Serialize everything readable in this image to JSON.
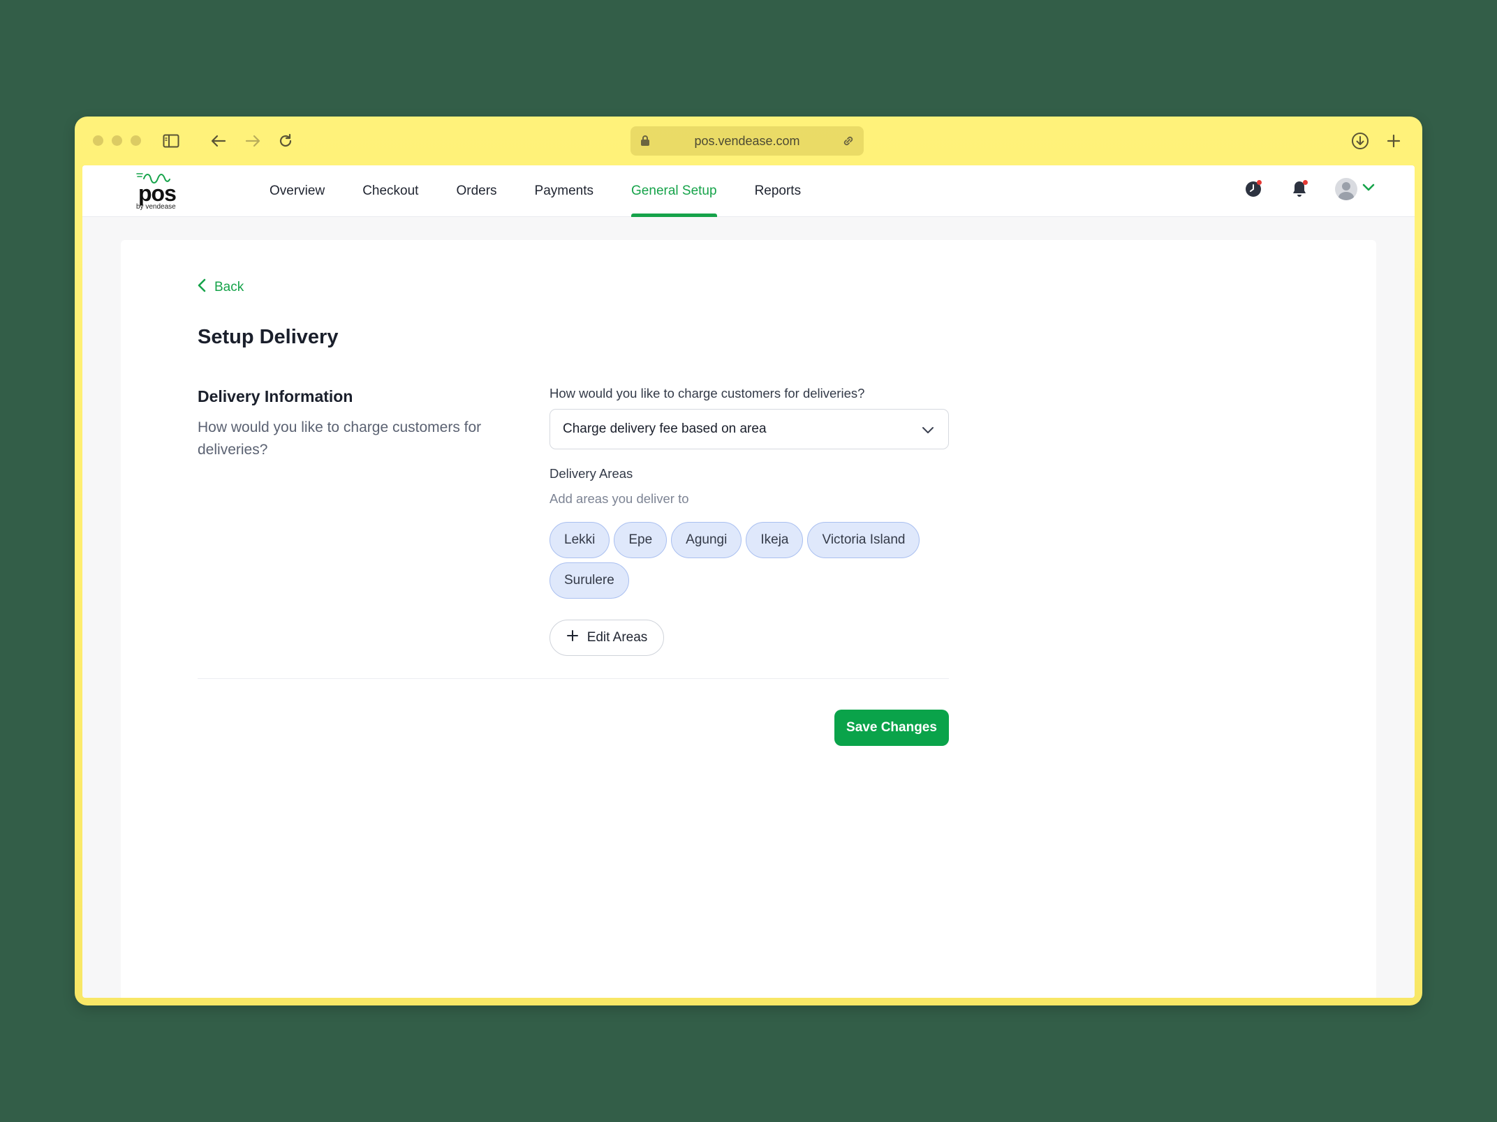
{
  "browser": {
    "url": "pos.vendease.com"
  },
  "app": {
    "logo_word": "pos",
    "logo_sub": "by vendease",
    "nav": [
      {
        "label": "Overview"
      },
      {
        "label": "Checkout"
      },
      {
        "label": "Orders"
      },
      {
        "label": "Payments"
      },
      {
        "label": "General Setup"
      },
      {
        "label": "Reports"
      }
    ],
    "active_nav": "General Setup",
    "accent_color": "#16a34a"
  },
  "page": {
    "back_label": "Back",
    "title": "Setup Delivery",
    "section_title": "Delivery Information",
    "section_desc": "How would you like to charge customers for deliveries?",
    "charge_question": "How would you like to charge customers for deliveries?",
    "charge_selected": "Charge delivery fee based on area",
    "areas_label": "Delivery Areas",
    "areas_sub": "Add areas you deliver to",
    "areas": [
      "Lekki",
      "Epe",
      "Agungi",
      "Ikeja",
      "Victoria Island",
      "Surulere"
    ],
    "edit_areas_label": "Edit Areas",
    "save_label": "Save Changes"
  }
}
